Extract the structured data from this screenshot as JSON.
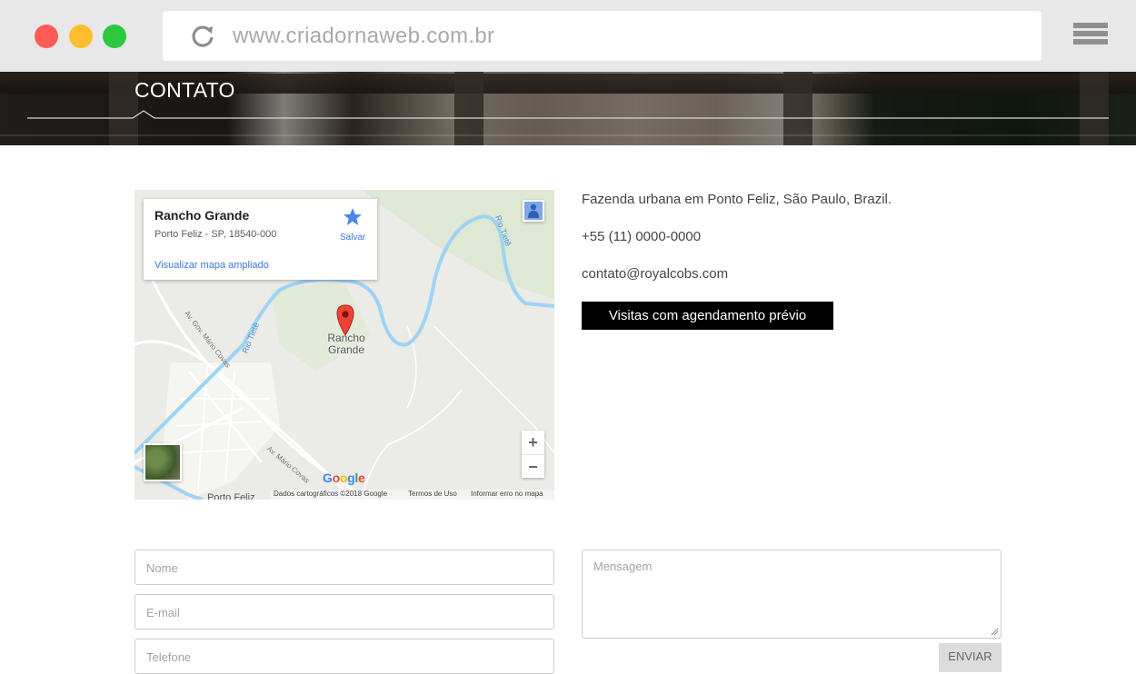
{
  "browser": {
    "url": "www.criadornaweb.com.br",
    "colors": {
      "close": "#fd5b55",
      "minimize": "#fdbe2e",
      "maximize": "#2bc840"
    }
  },
  "hero": {
    "title": "CONTATO"
  },
  "map": {
    "place_name": "Rancho Grande",
    "place_address": "Porto Feliz - SP, 18540-000",
    "save_label": "Salvar",
    "enlarge_link": "Visualizar mapa ampliado",
    "marker_label_line1": "Rancho",
    "marker_label_line2": "Grande",
    "river_labels": [
      "Rio Tietê",
      "Rio Tietê"
    ],
    "road_labels": [
      "Av. Gov. Mário Covas",
      "Av. Mário Covas"
    ],
    "town_label": "Porto Feliz",
    "zoom_in": "+",
    "zoom_out": "−",
    "google_logo": "Google",
    "attribution": "Dados cartográficos ©2018 Google",
    "terms": "Termos de Uso",
    "report": "Informar erro no mapa"
  },
  "contact": {
    "address": "Fazenda urbana em Ponto Feliz, São Paulo, Brazil.",
    "phone": "+55 (11) 0000-0000",
    "email": "contato@royalcobs.com",
    "visit_button": "Visitas com agendamento prévio"
  },
  "form": {
    "name_placeholder": "Nome",
    "email_placeholder": "E-mail",
    "phone_placeholder": "Telefone",
    "message_placeholder": "Mensagem",
    "submit_label": "ENVIAR"
  }
}
